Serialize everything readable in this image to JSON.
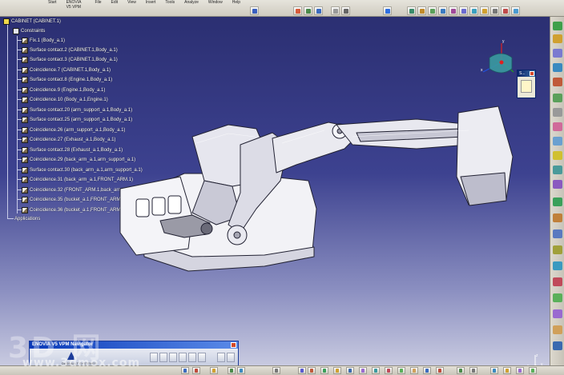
{
  "menubar": {
    "items": [
      "Start",
      "ENOVIA V5 VPM",
      "File",
      "Edit",
      "View",
      "Insert",
      "Tools",
      "Analyze",
      "Window",
      "Help"
    ]
  },
  "tree": {
    "root": "CABINET (CABINET.1)",
    "constraints": "Constraints",
    "items": [
      "Fix.1 (Body_a.1)",
      "Surface contact.2 (CABINET.1,Body_a.1)",
      "Surface contact.3 (CABINET.1,Body_a.1)",
      "Coincidence.7 (CABINET.1,Body_a.1)",
      "Surface contact.8 (Engine.1,Body_a.1)",
      "Coincidence.9 (Engine.1,Body_a.1)",
      "Coincidence.10 (Body_a.1,Engine.1)",
      "Surface contact.20 (arm_support_a.1,Body_a.1)",
      "Surface contact.25 (arm_support_a.1,Body_a.1)",
      "Coincidence.26 (arm_support_a.1,Body_a.1)",
      "Coincidence.27 (Exhaust_a.1,Body_a.1)",
      "Surface contact.28 (Exhaust_a.1,Body_a.1)",
      "Coincidence.29 (back_arm_a.1,arm_support_a.1)",
      "Surface contact.30 (back_arm_a.1,arm_support_a.1)",
      "Coincidence.31 (back_arm_a.1,FRONT_ARM.1)",
      "Coincidence.32 (FRONT_ARM.1,back_arm_a.1)",
      "Coincidence.35 (bucket_a.1,FRONT_ARM.1)",
      "Coincidence.36 (bucket_a.1,FRONT_ARM.1)"
    ],
    "applications": "Applications"
  },
  "compass": {
    "axis_y": "y",
    "axis_x": "x"
  },
  "mini_window": {
    "title": "S..."
  },
  "navigator": {
    "title": "ENOVIA V5 VPM Navigator",
    "logo": "DASSAULT SYSTEMES"
  },
  "watermark": {
    "cn": "3D 网",
    "url": "www.3dmox.com"
  },
  "axis": {
    "z": "z",
    "x": "x",
    "y": "y"
  },
  "colors": {
    "viewport_top": "#2b2f72",
    "viewport_bottom": "#c8cae0",
    "tree_text": "#ffffff",
    "model_fill": "#f2f2f6",
    "model_edge": "#222233"
  }
}
